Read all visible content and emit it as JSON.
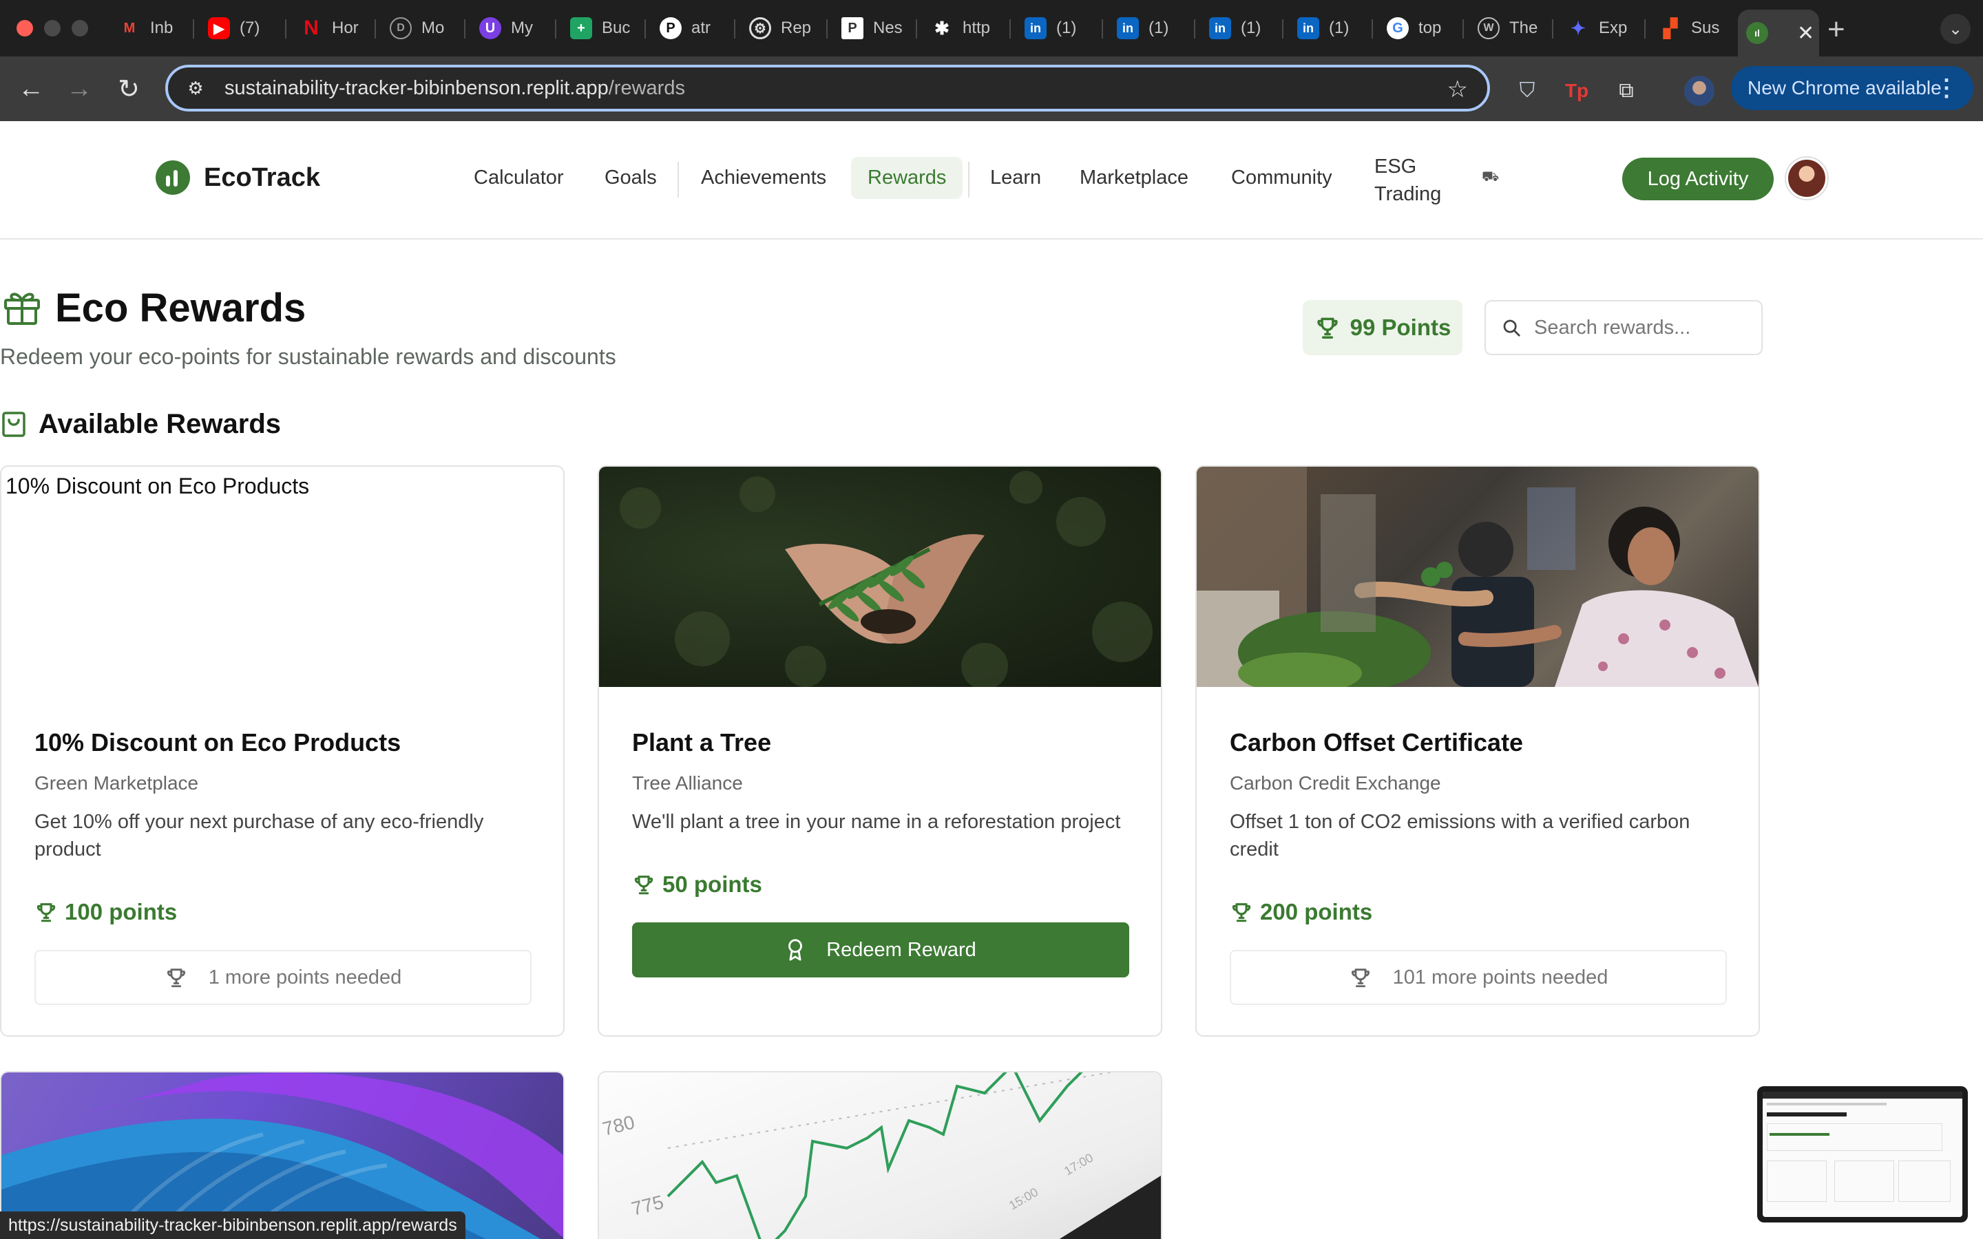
{
  "browser": {
    "tabs": [
      {
        "label": "Inb",
        "icon": "gmail-icon"
      },
      {
        "label": "(7)",
        "icon": "youtube-icon"
      },
      {
        "label": "Hor",
        "icon": "netflix-icon"
      },
      {
        "label": "Mo",
        "icon": "mo-icon"
      },
      {
        "label": "My",
        "icon": "u-icon"
      },
      {
        "label": "Buc",
        "icon": "sheets-icon"
      },
      {
        "label": "atr",
        "icon": "pocket-icon"
      },
      {
        "label": "Rep",
        "icon": "openai-icon"
      },
      {
        "label": "Nes",
        "icon": "p-icon"
      },
      {
        "label": "http",
        "icon": "bug-icon"
      },
      {
        "label": "(1)",
        "icon": "linkedin-icon"
      },
      {
        "label": "(1)",
        "icon": "linkedin-icon"
      },
      {
        "label": "(1)",
        "icon": "linkedin-icon"
      },
      {
        "label": "(1)",
        "icon": "linkedin-icon"
      },
      {
        "label": "top",
        "icon": "google-icon"
      },
      {
        "label": "The",
        "icon": "the-icon"
      },
      {
        "label": "Exp",
        "icon": "exp-icon"
      },
      {
        "label": "Sus",
        "icon": "figma-icon"
      }
    ],
    "url_host": "sustainability-tracker-bibinbenson.replit.app",
    "url_path": "/rewards",
    "update_label": "New Chrome available",
    "status_url": "https://sustainability-tracker-bibinbenson.replit.app/rewards"
  },
  "app": {
    "brand": "EcoTrack",
    "nav": {
      "calculator": "Calculator",
      "goals": "Goals",
      "achievements": "Achievements",
      "rewards": "Rewards",
      "learn": "Learn",
      "marketplace": "Marketplace",
      "community": "Community",
      "esg_1": "ESG",
      "esg_2": "Trading"
    },
    "log_activity": "Log Activity"
  },
  "page": {
    "title": "Eco Rewards",
    "subtitle": "Redeem your eco-points for sustainable rewards and discounts",
    "points_badge": "99 Points",
    "search_placeholder": "Search rewards...",
    "section_title": "Available Rewards"
  },
  "rewards": [
    {
      "image_alt": "10% Discount on Eco Products",
      "title": "10% Discount on Eco Products",
      "partner": "Green Marketplace",
      "description": "Get 10% off your next purchase of any eco-friendly product",
      "points": "100 points",
      "action": "1 more points needed"
    },
    {
      "title": "Plant a Tree",
      "partner": "Tree Alliance",
      "description": "We'll plant a tree in your name in a reforestation project",
      "points": "50 points",
      "action": "Redeem Reward"
    },
    {
      "title": "Carbon Offset Certificate",
      "partner": "Carbon Credit Exchange",
      "description": "Offset 1 ton of CO2 emissions with a verified carbon credit",
      "points": "200 points",
      "action": "101 more points needed"
    },
    {},
    {
      "chart_labels": [
        "780",
        "775"
      ]
    }
  ],
  "colors": {
    "brand_green": "#3d7a34",
    "accent_bg": "#edf4ea",
    "chrome_accent": "#a8c7fa"
  }
}
